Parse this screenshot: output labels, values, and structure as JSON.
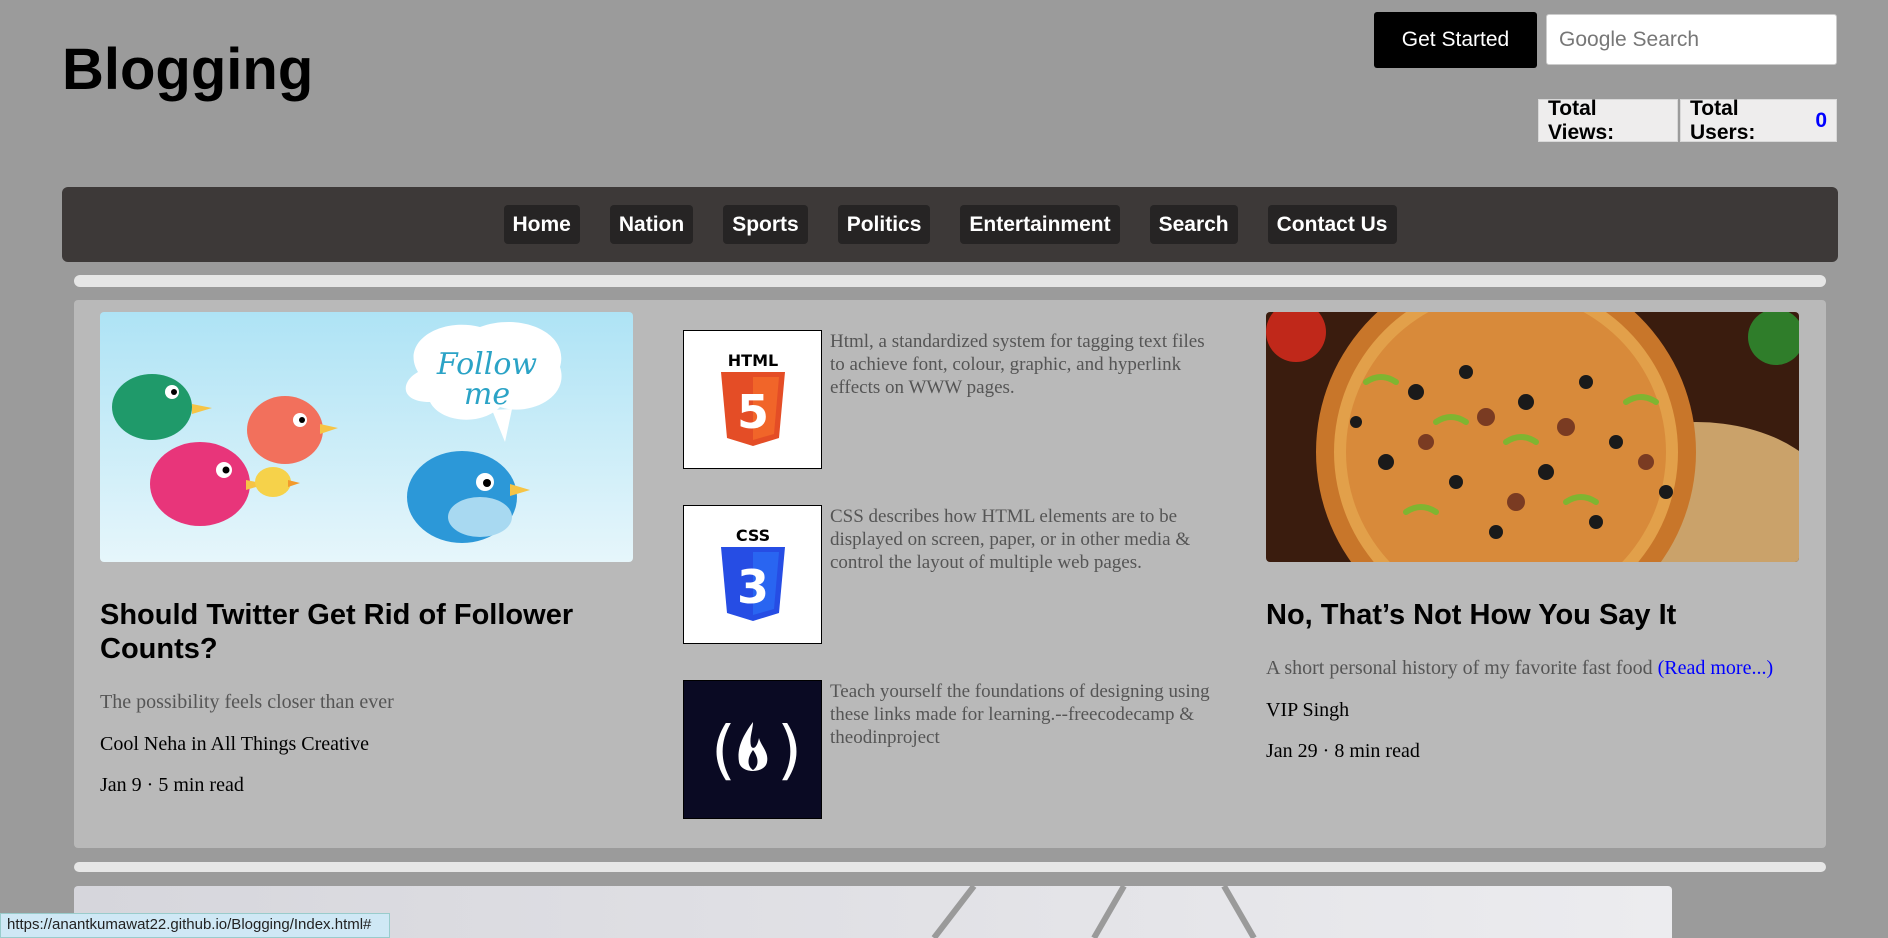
{
  "header": {
    "title": "Blogging",
    "get_started": "Get Started",
    "search_placeholder": "Google Search",
    "total_views_label": "Total Views:",
    "total_users_label": "Total Users:",
    "total_users_value": "0"
  },
  "nav": {
    "items": [
      "Home",
      "Nation",
      "Sports",
      "Politics",
      "Entertainment",
      "Search",
      "Contact Us"
    ]
  },
  "cards": {
    "left": {
      "image": "twitter-birds-follow-me",
      "title": "Should Twitter Get Rid of Follower Counts?",
      "subtitle": "The possibility feels closer than ever",
      "author": "Cool Neha in All Things Creative",
      "date_read": "Jan 9 · 5 min read"
    },
    "middle": [
      {
        "icon": "html5-logo",
        "text": "Html, a standardized system for tagging text files to achieve font, colour, graphic, and hyperlink effects on WWW pages."
      },
      {
        "icon": "css3-logo",
        "text": "CSS describes how HTML elements are to be displayed on screen, paper, or in other media & control the layout of multiple web pages."
      },
      {
        "icon": "freecodecamp-logo",
        "text": "Teach yourself the foundations of designing using these links made for learning.--freecodecamp & theodinproject"
      }
    ],
    "right": {
      "image": "pizza",
      "title": "No, That’s Not How You Say It",
      "subtitle": "A short personal history of my favorite fast food",
      "read_more": "(Read more...)",
      "author": "VIP Singh",
      "date_read": "Jan 29 · 8 min read"
    }
  },
  "status_url": "https://anantkumawat22.github.io/Blogging/Index.html#",
  "colors": {
    "background": "#9b9b9b",
    "navbar": "#3d3938",
    "accent_link": "#0000ff"
  }
}
